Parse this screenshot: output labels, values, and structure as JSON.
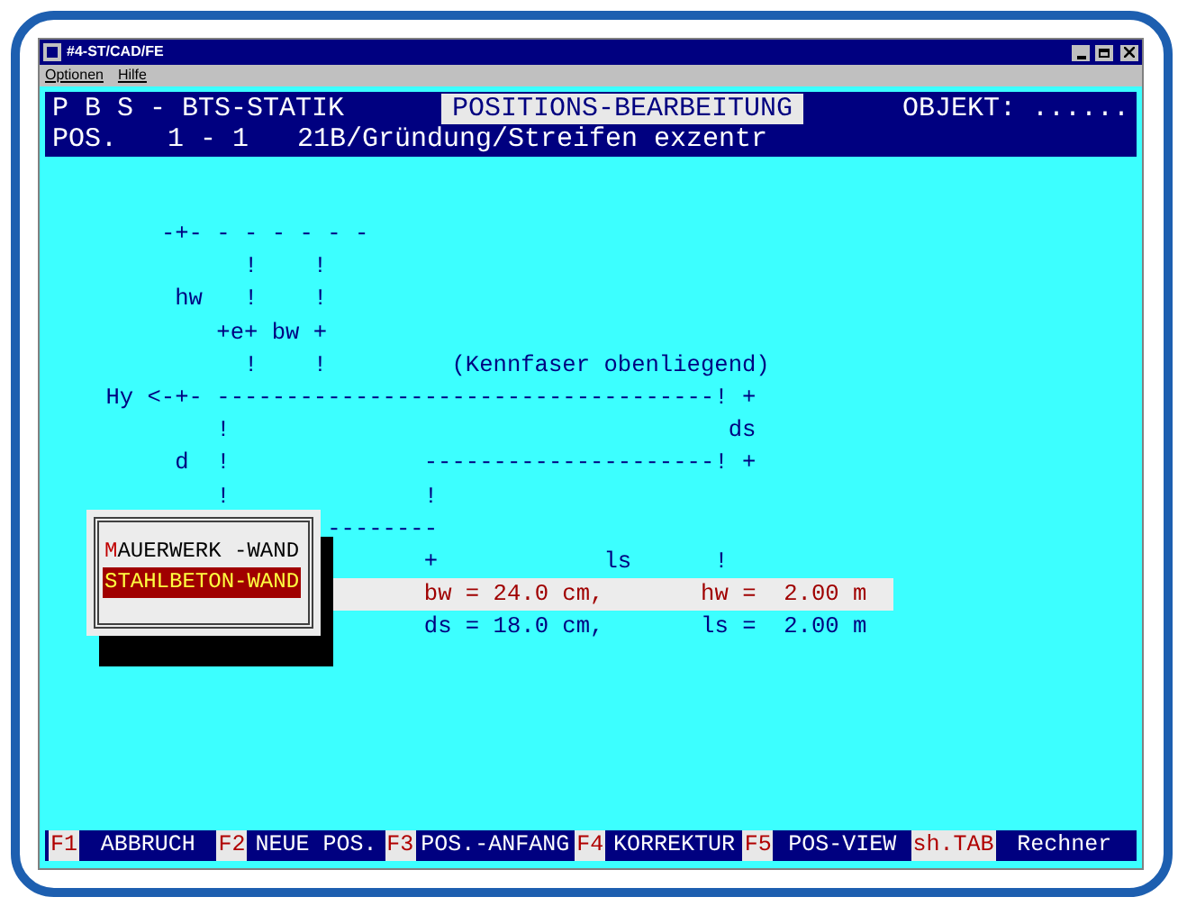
{
  "window": {
    "title": "#4-ST/CAD/FE"
  },
  "menu": [
    "Optionen",
    "Hilfe"
  ],
  "header": {
    "program": "P B S - BTS-STATIK",
    "mode": "POSITIONS-BEARBEITUNG",
    "object": "OBJEKT: ......",
    "position_label": "POS.",
    "position": "1 - 1",
    "description": "21B/Gründung/Streifen exzentr"
  },
  "diagram_lines": [
    "        -+- - - - - - -",
    "              !    !",
    "         hw   !    !",
    "            +e+ bw +",
    "              !    !         (Kennfaser obenliegend)",
    "    Hy <-+- ------------------------------------! +",
    "            !                                    ds",
    "         d  !              ---------------------! +",
    "            !              !",
    "                    --------",
    "                           +            ls      !"
  ],
  "values": [
    {
      "left": "bw = 24.0 cm,",
      "right": "hw =  2.00 m",
      "selected": true
    },
    {
      "left": "ds = 18.0 cm,",
      "right": "ls =  2.00 m",
      "selected": false
    }
  ],
  "popup": {
    "items": [
      {
        "label": "MAUERWERK -WAND",
        "selected": false
      },
      {
        "label": "STAHLBETON-WAND",
        "selected": true
      }
    ]
  },
  "function_keys": [
    {
      "key": "F1",
      "action": "ABBRUCH"
    },
    {
      "key": "F2",
      "action": "NEUE POS."
    },
    {
      "key": "F3",
      "action": "POS.-ANFANG"
    },
    {
      "key": "F4",
      "action": "KORREKTUR"
    },
    {
      "key": "F5",
      "action": "POS-VIEW"
    },
    {
      "key": "sh.TAB",
      "action": "Rechner"
    }
  ]
}
